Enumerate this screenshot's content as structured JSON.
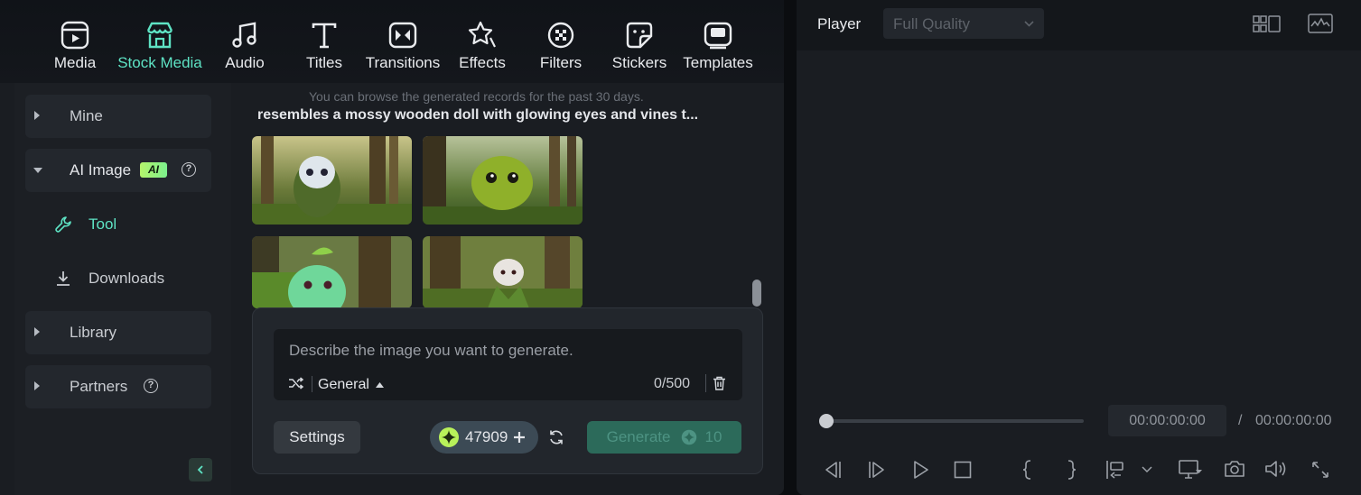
{
  "toolbar": {
    "tabs": [
      {
        "label": "Media",
        "icon": "media-icon"
      },
      {
        "label": "Stock Media",
        "icon": "stock-media-icon"
      },
      {
        "label": "Audio",
        "icon": "audio-icon"
      },
      {
        "label": "Titles",
        "icon": "titles-icon"
      },
      {
        "label": "Transitions",
        "icon": "transitions-icon"
      },
      {
        "label": "Effects",
        "icon": "effects-icon"
      },
      {
        "label": "Filters",
        "icon": "filters-icon"
      },
      {
        "label": "Stickers",
        "icon": "stickers-icon"
      },
      {
        "label": "Templates",
        "icon": "templates-icon"
      }
    ],
    "active_tab": "Stock Media",
    "accent_color": "#5ee3c4"
  },
  "sidebar": {
    "items": [
      {
        "label": "Mine",
        "expanded": false
      },
      {
        "label": "AI Image",
        "badge": "AI",
        "expanded": true
      },
      {
        "label": "Library",
        "expanded": false
      },
      {
        "label": "Partners",
        "expanded": false
      }
    ],
    "sub_items": [
      {
        "label": "Tool",
        "icon": "wrench-icon",
        "active": true
      },
      {
        "label": "Downloads",
        "icon": "download-icon"
      }
    ],
    "help_symbol": "?"
  },
  "content": {
    "hint": "You can browse the generated records for the past 30 days.",
    "prompt_title": "resembles a mossy wooden doll with glowing eyes and vines t...",
    "images": [
      {
        "name": "generated-image-1"
      },
      {
        "name": "generated-image-2"
      },
      {
        "name": "generated-image-3"
      },
      {
        "name": "generated-image-4"
      }
    ]
  },
  "generator": {
    "placeholder": "Describe the image you want to generate.",
    "style": "General",
    "char_count": "0/500",
    "settings_label": "Settings",
    "credits": "47909",
    "generate_label": "Generate",
    "generate_cost": "10"
  },
  "player": {
    "label": "Player",
    "quality": "Full Quality",
    "current_time": "00:00:00:00",
    "separator": "/",
    "total_time": "00:00:00:00",
    "progress": 0
  }
}
